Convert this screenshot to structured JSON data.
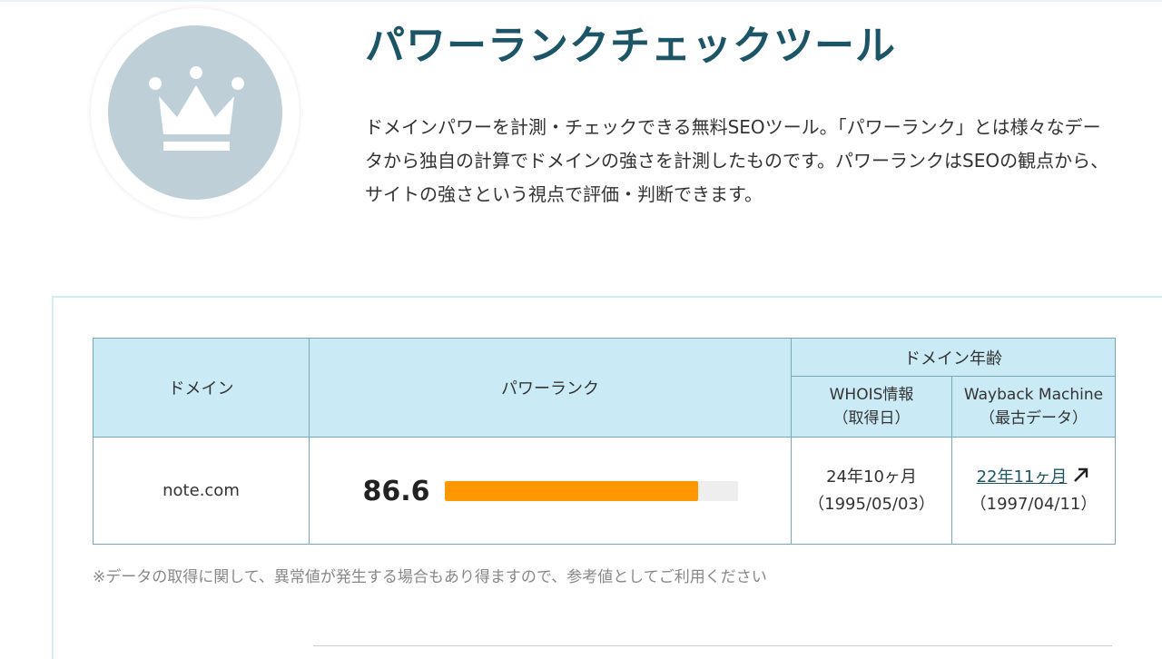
{
  "header": {
    "title": "パワーランクチェックツール",
    "description": "ドメインパワーを計測・チェックできる無料SEOツール。「パワーランク」とは様々なデータから独自の計算でドメインの強さを計測したものです。パワーランクはSEOの観点から、サイトの強さという視点で評価・判断できます。",
    "logo_icon": "crown-icon"
  },
  "table": {
    "headers": {
      "domain": "ドメイン",
      "power_rank": "パワーランク",
      "domain_age": "ドメイン年齢",
      "whois_line1": "WHOIS情報",
      "whois_line2": "（取得日）",
      "wayback_line1": "Wayback Machine",
      "wayback_line2": "（最古データ）"
    },
    "row": {
      "domain": "note.com",
      "power_rank": "86.6",
      "power_rank_percent": 86.6,
      "whois_age": "24年10ヶ月",
      "whois_date": "（1995/05/03）",
      "wayback_age": "22年11ヶ月",
      "wayback_date": "（1997/04/11）"
    }
  },
  "note": "※データの取得に関して、異常値が発生する場合もあり得ますので、参考値としてご利用ください",
  "colors": {
    "title": "#1c5566",
    "header_bg": "#caeaf5",
    "bar_fill": "#ff9800",
    "logo_bg": "#bfcfd8"
  },
  "icons": {
    "external": "external-link-arrow-icon"
  }
}
